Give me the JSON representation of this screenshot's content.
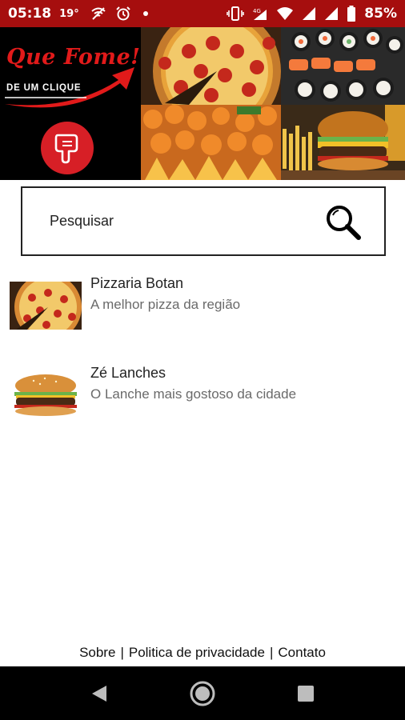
{
  "status_bar": {
    "time": "05:18",
    "temperature": "19°",
    "battery": "85%",
    "bg_color": "#a60e0e"
  },
  "banner": {
    "brand_title": "Que Fome!",
    "brand_subtitle": "DE UM CLIQUE",
    "brand_color": "#e11a1a",
    "tiles": [
      "pizza-image",
      "sushi-image",
      "snacks-image",
      "burger-image"
    ]
  },
  "search": {
    "placeholder": "Pesquisar",
    "icon": "search-icon"
  },
  "restaurants": [
    {
      "name": "Pizzaria Botan",
      "description": "A melhor pizza da região",
      "image": "pizza-thumbnail"
    },
    {
      "name": "Zé Lanches",
      "description": "O Lanche mais gostoso da cidade",
      "image": "burger-thumbnail"
    }
  ],
  "footer": {
    "about": "Sobre",
    "separator": "|",
    "privacy": "Politica de privacidade",
    "contact": "Contato"
  },
  "nav_bar": {
    "buttons": [
      "back-icon",
      "home-icon",
      "recents-icon"
    ]
  }
}
